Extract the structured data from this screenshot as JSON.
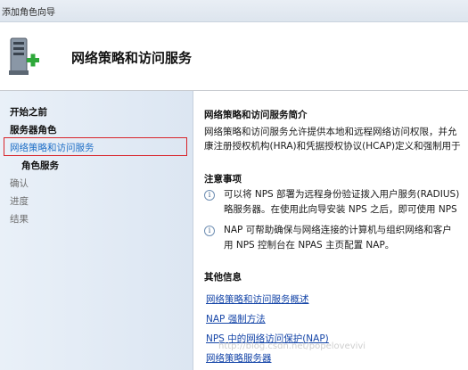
{
  "window": {
    "title": "添加角色向导"
  },
  "header": {
    "heading": "网络策略和访问服务",
    "icon": "server-add-icon"
  },
  "sidebar": {
    "items": [
      {
        "label": "开始之前"
      },
      {
        "label": "服务器角色"
      },
      {
        "label": "网络策略和访问服务",
        "selected": true
      },
      {
        "label": "角色服务"
      },
      {
        "label": "确认"
      },
      {
        "label": "进度"
      },
      {
        "label": "结果"
      }
    ]
  },
  "content": {
    "intro": {
      "title": "网络策略和访问服务简介",
      "line1": "网络策略和访问服务允许提供本地和远程网络访问权限，并允",
      "line2": "康注册授权机构(HRA)和凭据授权协议(HCAP)定义和强制用于"
    },
    "notes": {
      "title": "注意事项",
      "note1_line1": "可以将 NPS 部署为远程身份验证拨入用户服务(RADIUS)",
      "note1_line2": "略服务器。在使用此向导安装 NPS 之后，即可使用 NPS",
      "note2_line1": "NAP 可帮助确保与网络连接的计算机与组织网络和客户",
      "note2_line2": "用 NPS 控制台在 NPAS 主页配置 NAP。"
    },
    "more": {
      "title": "其他信息",
      "links": [
        "网络策略和访问服务概述",
        "NAP 强制方法",
        "NPS 中的网络访问保护(NAP)",
        "网络策略服务器"
      ]
    }
  },
  "watermark": "http://blog.csdn.net/popelovevivi"
}
